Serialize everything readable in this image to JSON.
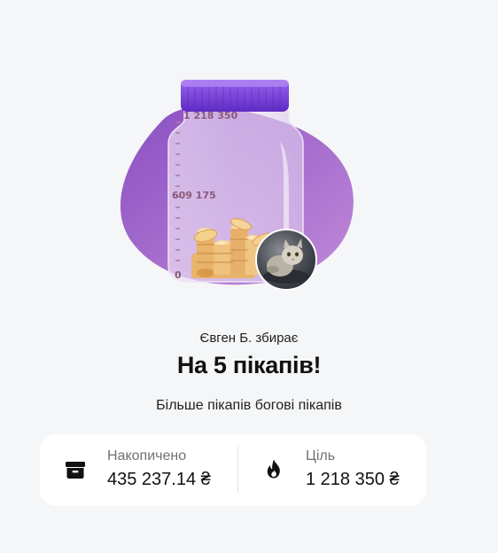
{
  "jar": {
    "scale_max": "1 218 350",
    "scale_mid": "609 175",
    "scale_min": "0",
    "fill_fraction": 0.357
  },
  "collection": {
    "owner_line": "Євген Б. збирає",
    "title": "На 5 пікапів!",
    "description": "Більше пікапів богові пікапів"
  },
  "stats": {
    "accumulated_label": "Накопичено",
    "accumulated_value": "435 237.14 ₴",
    "accumulated_icon": "archive-box-icon",
    "goal_label": "Ціль",
    "goal_value": "1 218 350 ₴",
    "goal_icon": "flame-icon"
  },
  "colors": {
    "blob": "#9c5ec8",
    "lid": "#7b3fe0",
    "background": "#f5f6f7"
  }
}
